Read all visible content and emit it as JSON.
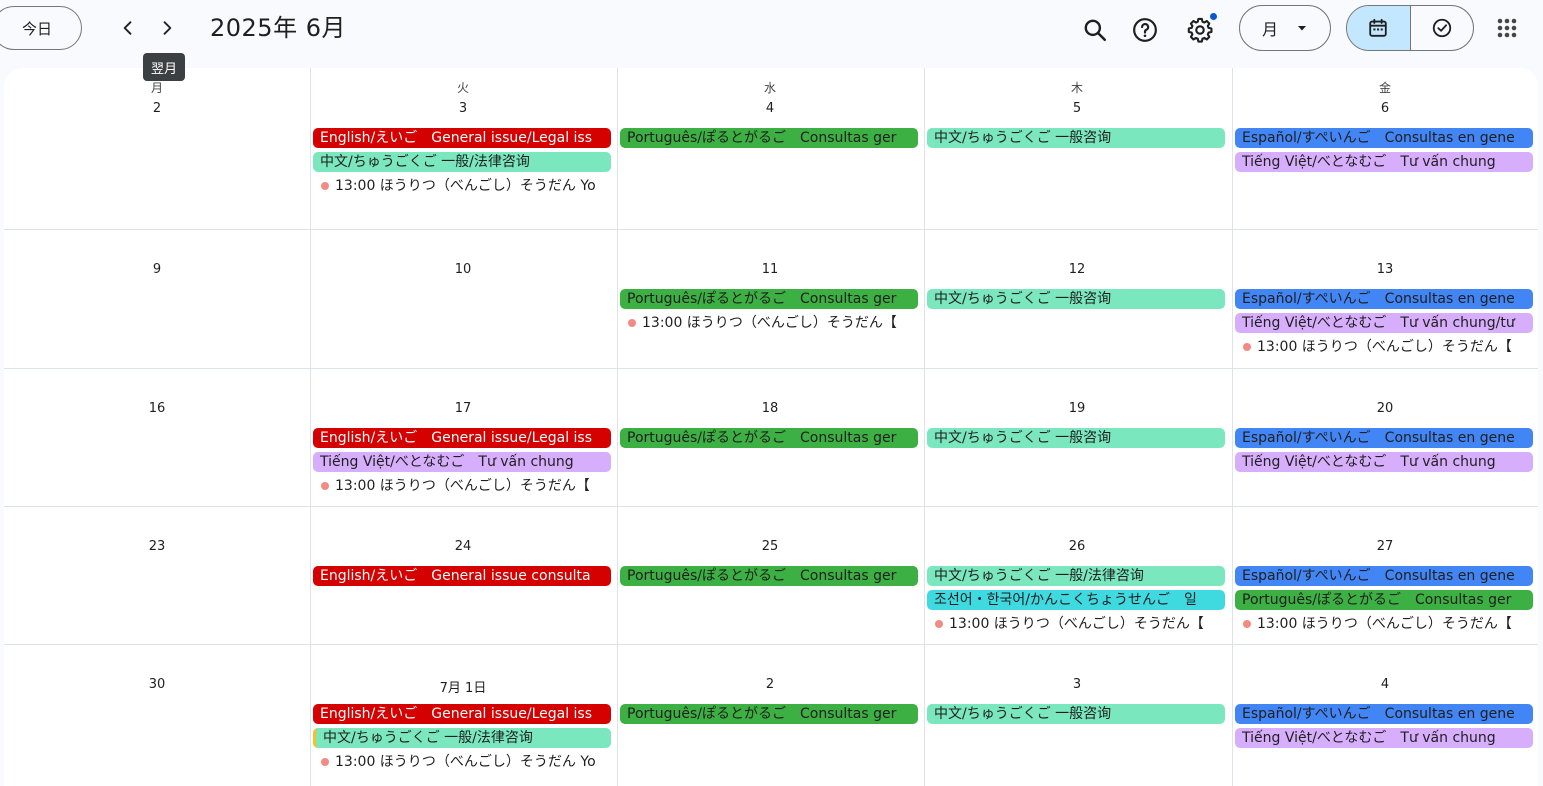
{
  "header": {
    "today_label": "今日",
    "tooltip": "翌月",
    "title": "2025年 6月",
    "view_label": "月",
    "icons": [
      "chevron-left-icon",
      "chevron-right-icon",
      "search-icon",
      "help-icon",
      "settings-icon",
      "caret-down-icon",
      "calendar-icon",
      "task-check-icon",
      "apps-grid-icon"
    ]
  },
  "weekdays": [
    "月",
    "火",
    "水",
    "木",
    "金"
  ],
  "weeks": [
    {
      "days": [
        {
          "num": "2",
          "events": []
        },
        {
          "num": "3",
          "events": [
            {
              "type": "bar",
              "color": "red",
              "text": "English/えいご　General issue/Legal iss"
            },
            {
              "type": "bar",
              "color": "mint",
              "text": "中文/ちゅうごくご 一般/法律咨询"
            },
            {
              "type": "dot",
              "text": "13:00 ほうりつ（べんごし）そうだん Yo"
            }
          ]
        },
        {
          "num": "4",
          "events": [
            {
              "type": "bar",
              "color": "green",
              "text": "Português/ぽるとがるご　Consultas ger"
            }
          ]
        },
        {
          "num": "5",
          "events": [
            {
              "type": "bar",
              "color": "mint",
              "text": "中文/ちゅうごくご 一般咨询"
            }
          ]
        },
        {
          "num": "6",
          "events": [
            {
              "type": "bar",
              "color": "blue",
              "text": "Español/すぺいんご　Consultas en gene"
            },
            {
              "type": "bar",
              "color": "lav",
              "text": "Tiếng Việt/べとなむご　Tư vấn chung"
            }
          ]
        }
      ]
    },
    {
      "days": [
        {
          "num": "9",
          "events": []
        },
        {
          "num": "10",
          "events": []
        },
        {
          "num": "11",
          "events": [
            {
              "type": "bar",
              "color": "green",
              "text": "Português/ぽるとがるご　Consultas ger"
            },
            {
              "type": "dot",
              "text": "13:00 ほうりつ（べんごし）そうだん【"
            }
          ]
        },
        {
          "num": "12",
          "events": [
            {
              "type": "bar",
              "color": "mint",
              "text": "中文/ちゅうごくご 一般咨询"
            }
          ]
        },
        {
          "num": "13",
          "events": [
            {
              "type": "bar",
              "color": "blue",
              "text": "Español/すぺいんご　Consultas en gene"
            },
            {
              "type": "bar",
              "color": "lav",
              "text": "Tiếng Việt/べとなむご　Tư vấn chung/tư"
            },
            {
              "type": "dot",
              "text": "13:00 ほうりつ（べんごし）そうだん【"
            }
          ]
        }
      ]
    },
    {
      "days": [
        {
          "num": "16",
          "events": []
        },
        {
          "num": "17",
          "events": [
            {
              "type": "bar",
              "color": "red",
              "text": "English/えいご　General issue/Legal iss"
            },
            {
              "type": "bar",
              "color": "lav",
              "text": "Tiếng Việt/べとなむご　Tư vấn chung"
            },
            {
              "type": "dot",
              "text": "13:00 ほうりつ（べんごし）そうだん【"
            }
          ]
        },
        {
          "num": "18",
          "events": [
            {
              "type": "bar",
              "color": "green",
              "text": "Português/ぽるとがるご　Consultas ger"
            }
          ]
        },
        {
          "num": "19",
          "events": [
            {
              "type": "bar",
              "color": "mint",
              "text": "中文/ちゅうごくご 一般咨询"
            }
          ]
        },
        {
          "num": "20",
          "events": [
            {
              "type": "bar",
              "color": "blue",
              "text": "Español/すぺいんご　Consultas en gene"
            },
            {
              "type": "bar",
              "color": "lav",
              "text": "Tiếng Việt/べとなむご　Tư vấn chung"
            }
          ]
        }
      ]
    },
    {
      "days": [
        {
          "num": "23",
          "events": []
        },
        {
          "num": "24",
          "events": [
            {
              "type": "bar",
              "color": "red",
              "text": "English/えいご　General issue consulta"
            }
          ]
        },
        {
          "num": "25",
          "events": [
            {
              "type": "bar",
              "color": "green",
              "text": "Português/ぽるとがるご　Consultas ger"
            }
          ]
        },
        {
          "num": "26",
          "events": [
            {
              "type": "bar",
              "color": "mint",
              "text": "中文/ちゅうごくご 一般/法律咨询"
            },
            {
              "type": "bar",
              "color": "cyan",
              "text": "조선어・한국어/かんこくちょうせんご　일"
            },
            {
              "type": "dot",
              "text": "13:00 ほうりつ（べんごし）そうだん【"
            }
          ]
        },
        {
          "num": "27",
          "events": [
            {
              "type": "bar",
              "color": "blue",
              "text": "Español/すぺいんご　Consultas en gene"
            },
            {
              "type": "bar",
              "color": "green",
              "text": "Português/ぽるとがるご　Consultas ger"
            },
            {
              "type": "dot",
              "text": "13:00 ほうりつ（べんごし）そうだん【"
            }
          ]
        }
      ]
    },
    {
      "days": [
        {
          "num": "30",
          "events": []
        },
        {
          "num": "7月 1日",
          "events": [
            {
              "type": "bar",
              "color": "red",
              "text": "English/えいご　General issue/Legal iss"
            },
            {
              "type": "bar",
              "color": "mint",
              "text": "中文/ちゅうごくご 一般/法律咨询",
              "edge": "yellow"
            },
            {
              "type": "dot",
              "text": "13:00 ほうりつ（べんごし）そうだん Yo"
            }
          ]
        },
        {
          "num": "2",
          "events": [
            {
              "type": "bar",
              "color": "green",
              "text": "Português/ぽるとがるご　Consultas ger"
            }
          ]
        },
        {
          "num": "3",
          "events": [
            {
              "type": "bar",
              "color": "mint",
              "text": "中文/ちゅうごくご 一般咨询"
            }
          ]
        },
        {
          "num": "4",
          "events": [
            {
              "type": "bar",
              "color": "blue",
              "text": "Español/すぺいんご　Consultas en gene"
            },
            {
              "type": "bar",
              "color": "lav",
              "text": "Tiếng Việt/べとなむご　Tư vấn chung"
            }
          ]
        }
      ]
    }
  ]
}
